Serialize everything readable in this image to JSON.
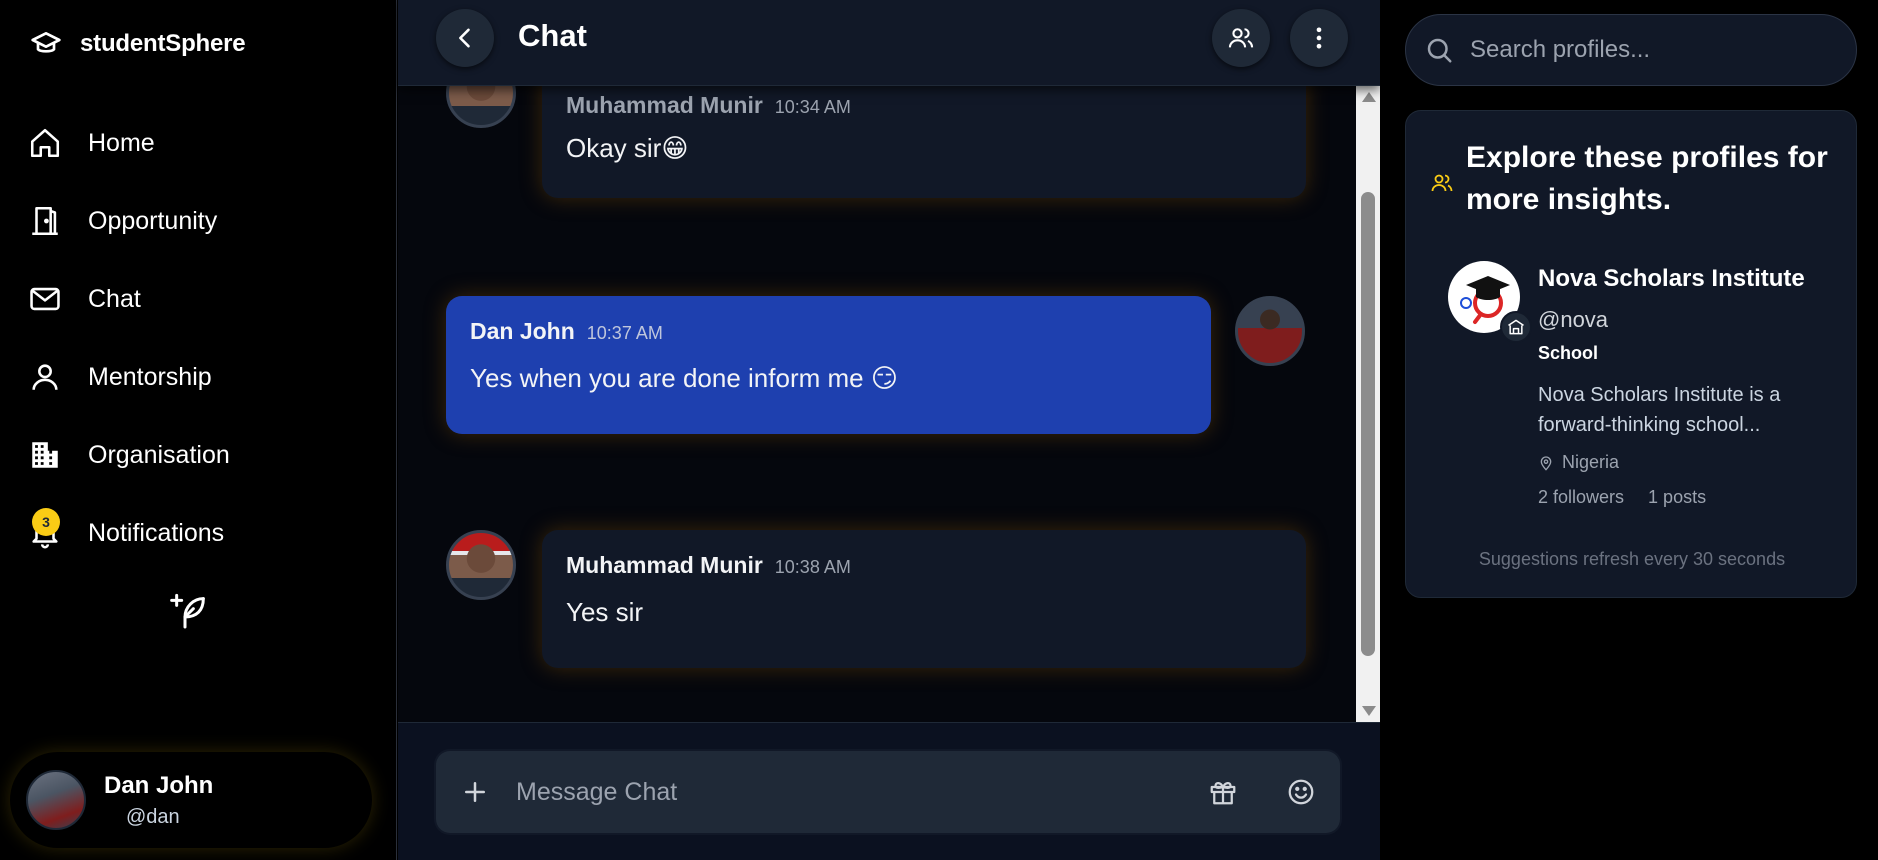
{
  "app": {
    "brand": "studentSphere"
  },
  "sidebar": {
    "items": [
      {
        "label": "Home",
        "icon": "home-icon"
      },
      {
        "label": "Opportunity",
        "icon": "door-icon"
      },
      {
        "label": "Chat",
        "icon": "mail-icon"
      },
      {
        "label": "Mentorship",
        "icon": "user-icon"
      },
      {
        "label": "Organisation",
        "icon": "building-icon"
      },
      {
        "label": "Notifications",
        "icon": "bell-icon",
        "badge": "3"
      }
    ],
    "compose_icon": "feather-plus-icon"
  },
  "current_user": {
    "name": "Dan John",
    "handle": "@dan"
  },
  "chat": {
    "title": "Chat",
    "messages": [
      {
        "author": "Muhammad Munir",
        "time": "10:34 AM",
        "text": "Okay sir😁",
        "mine": false
      },
      {
        "author": "Dan John",
        "time": "10:37 AM",
        "text": "Yes when you are done inform me 😏",
        "mine": true
      },
      {
        "author": "Muhammad Munir",
        "time": "10:38 AM",
        "text": "Yes sir",
        "mine": false
      }
    ],
    "composer_placeholder": "Message Chat"
  },
  "right": {
    "search_placeholder": "Search profiles...",
    "explore_title": "Explore these profiles for more insights.",
    "profile": {
      "name": "Nova Scholars Institute",
      "handle": "@nova",
      "type": "School",
      "description": "Nova Scholars Institute is a forward-thinking school...",
      "location": "Nigeria",
      "followers": "2 followers",
      "posts": "1 posts"
    },
    "refresh_note": "Suggestions refresh every 30 seconds"
  },
  "colors": {
    "accent_yellow": "#facc15",
    "my_bubble": "#1e40af",
    "panel": "#111827"
  }
}
